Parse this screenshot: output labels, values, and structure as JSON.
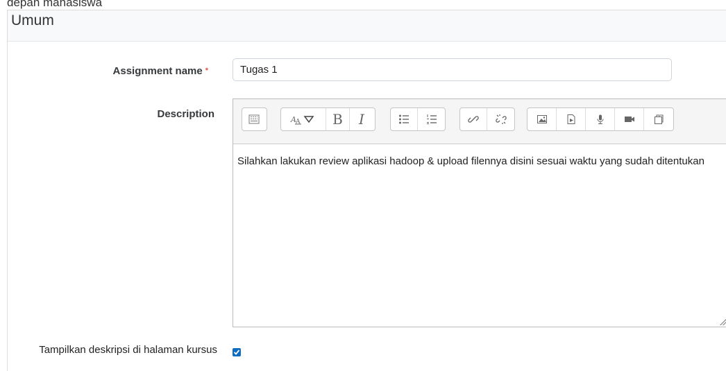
{
  "top_text": "depan mahasiswa",
  "section": {
    "legend": "Umum"
  },
  "assignment_name": {
    "label": "Assignment name",
    "required_marker": "*",
    "value": "Tugas 1"
  },
  "description": {
    "label": "Description",
    "text": "Silahkan lakukan review aplikasi hadoop & upload filennya disini sesuai waktu yang sudah ditentukan"
  },
  "toolbar": {
    "groups": [
      [
        "toggle-toolbar-icon"
      ],
      [
        "font-style-icon",
        "bold-icon",
        "italic-icon"
      ],
      [
        "bullet-list-icon",
        "numbered-list-icon"
      ],
      [
        "link-icon",
        "unlink-icon"
      ],
      [
        "image-icon",
        "media-icon",
        "microphone-icon",
        "video-icon",
        "manage-files-icon"
      ]
    ],
    "bold_glyph": "B",
    "italic_glyph": "I"
  },
  "show_description": {
    "label": "Tampilkan deskripsi di halaman kursus",
    "checked": true
  },
  "colors": {
    "accent": "#0f6cbf",
    "required": "#d9534f"
  }
}
